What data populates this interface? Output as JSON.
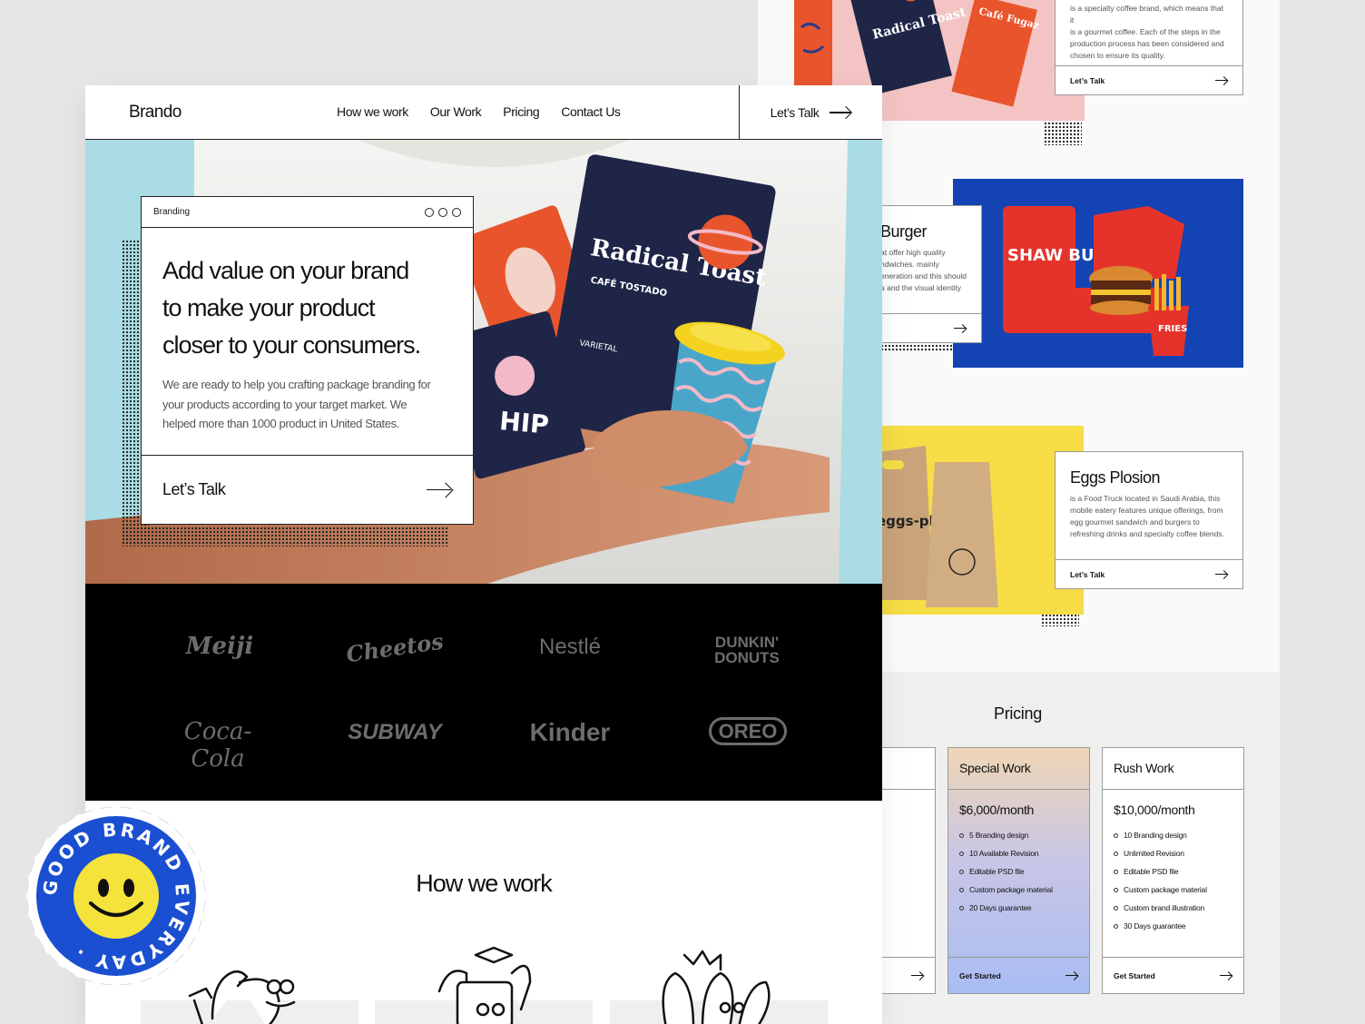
{
  "nav": {
    "logo": "Brando",
    "links": [
      "How we work",
      "Our Work",
      "Pricing",
      "Contact Us"
    ],
    "cta": "Let’s Talk"
  },
  "hero": {
    "card_tag": "Branding",
    "headline_lines": [
      "Add value on your brand",
      "to make your product",
      "closer to your consumers."
    ],
    "body_lines": [
      "We are ready to help you crafting package branding for",
      "your products according to your target market. We",
      "helped more than 1000 product in United States."
    ],
    "cta": "Let’s Talk",
    "package_text": {
      "brand": "Radical Toast",
      "sub": "CAFÉ TOSTADO",
      "varietal": "VARIETAL",
      "hip": "HIP"
    }
  },
  "brand_logos": [
    "Meiji",
    "Cheetos",
    "Nestlé",
    "DUNKIN' DONUTS",
    "Coca-Cola",
    "SUBWAY",
    "Kinder",
    "OREO"
  ],
  "how_we_work": {
    "title": "How we work"
  },
  "portfolio": {
    "coffee": {
      "desc_lines": [
        "is a specialty coffee brand, which means that it",
        "is a gourmet coffee. Each of the steps in the",
        "production process has been considered and",
        "chosen to ensure its quality."
      ],
      "cta": "Let’s Talk",
      "package_labels": [
        "Radical Toast",
        "Café Fugaz"
      ]
    },
    "burger": {
      "title": "Burger",
      "desc_lines": [
        "at offer high quality",
        "ndwiches. mainly",
        "eneration and this should",
        "a and the visual identity"
      ],
      "bag_text": "SHAW BURG",
      "fries_text": "FRIES"
    },
    "eggs": {
      "title": "Eggs Plosion",
      "desc_lines": [
        "is a Food Truck located in Saudi Arabia, this",
        "mobile eatery features unique offerings, from",
        "egg gourmet sandwich and burgers to",
        "refreshing drinks and specialty coffee blends."
      ],
      "cta": "Let’s Talk",
      "bag_text": "eggs-plosion"
    }
  },
  "pricing": {
    "title": "Pricing",
    "plans": [
      {
        "name": "Special Work",
        "price": "$6,000/month",
        "features": [
          "5 Branding design",
          "10 Available Revision",
          "Editable PSD file",
          "Custom package material",
          "20 Days guarantee"
        ],
        "cta": "Get Started"
      },
      {
        "name": "Rush Work",
        "price": "$10,000/month",
        "features": [
          "10 Branding design",
          "Unlimited Revision",
          "Editable PSD file",
          "Custom package material",
          "Custom brand illustration",
          "30 Days guarantee"
        ],
        "cta": "Get Started"
      }
    ]
  },
  "badge": {
    "text": "GOOD BRAND EVERYDAY ·"
  },
  "colors": {
    "hero_bg": "#a9dce4",
    "burger_bg": "#1444b4",
    "eggs_bg": "#f6dd46",
    "coffee_bg": "#f3c4c3",
    "badge_blue": "#1b4fd1",
    "badge_yellow": "#f4e33a",
    "logos_bg": "#000000"
  }
}
